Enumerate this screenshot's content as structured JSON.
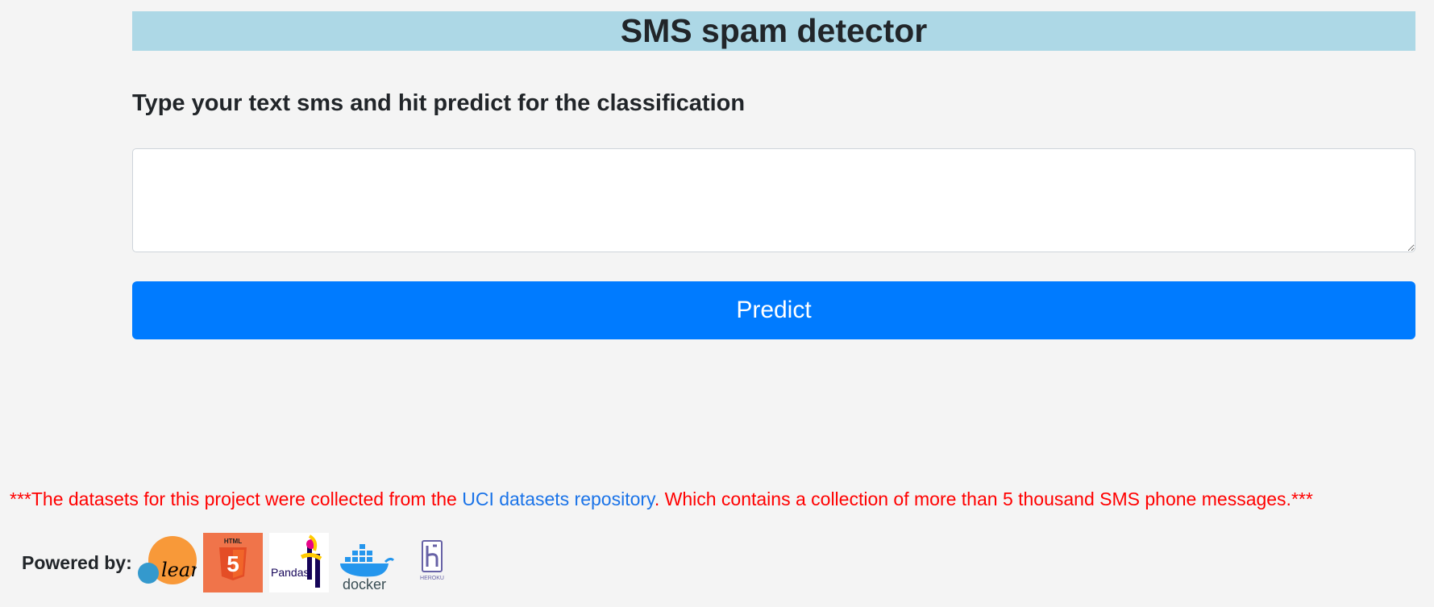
{
  "header": {
    "title": "SMS spam detector",
    "background_color": "#add8e6"
  },
  "form": {
    "instruction": "Type your text sms and hit predict for the classification",
    "textarea_value": "",
    "predict_label": "Predict",
    "predict_color": "#007bff"
  },
  "footer": {
    "note_prefix": "***The datasets for this project were collected from the ",
    "note_link": "UCI datasets repository",
    "note_suffix": ". Which contains a collection of more than 5 thousand SMS phone messages.***",
    "note_color": "#ff0000",
    "link_color": "#1a73e8",
    "powered_label": "Powered by:",
    "logos": [
      {
        "icon": "scikit-learn-logo",
        "text": "learn"
      },
      {
        "icon": "html5-logo",
        "text": "HTML"
      },
      {
        "icon": "pandas-logo",
        "text": "Pandas"
      },
      {
        "icon": "docker-logo",
        "text": "docker"
      },
      {
        "icon": "heroku-logo",
        "text": "HEROKU"
      }
    ]
  }
}
